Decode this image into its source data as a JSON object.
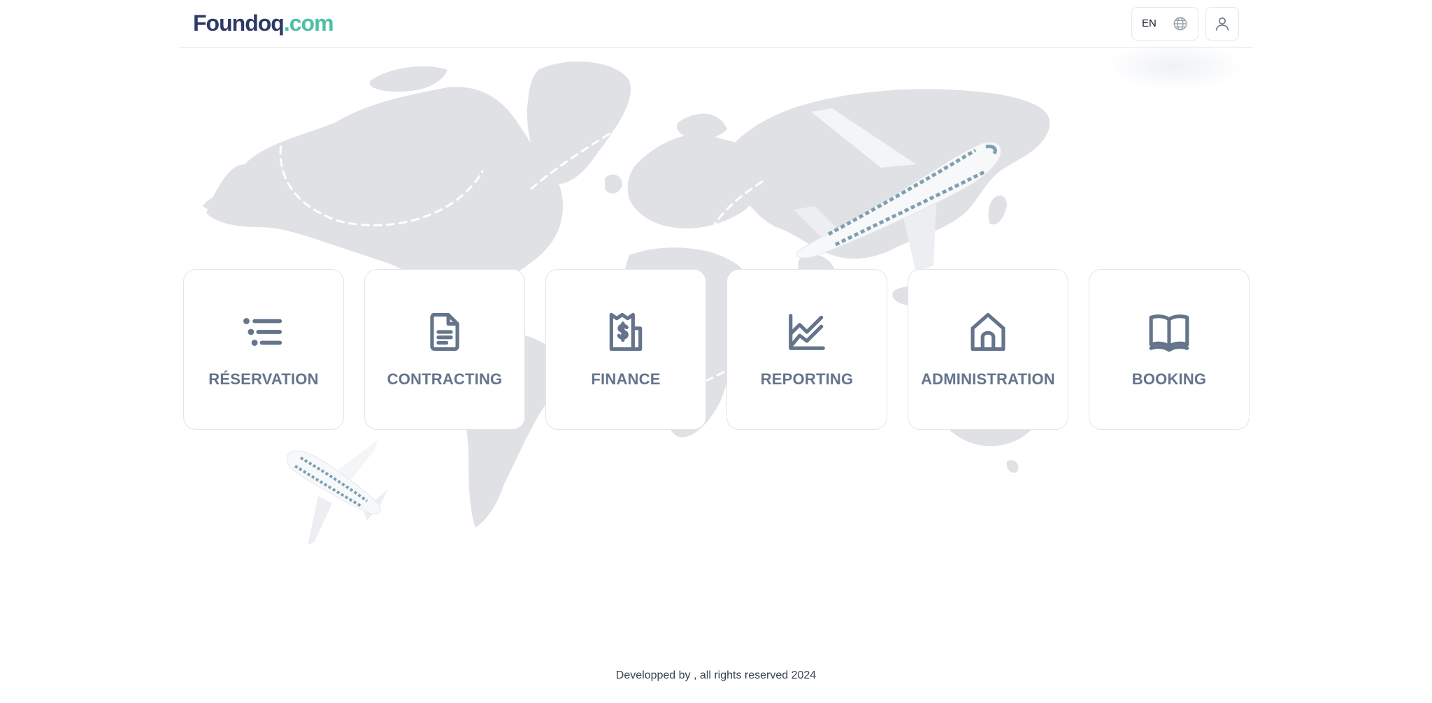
{
  "header": {
    "logo_part1": "Foundoq",
    "logo_part2": ".com",
    "language": "EN"
  },
  "icons": {
    "language": "globe-icon",
    "account": "user-icon"
  },
  "cards": [
    {
      "label": "RÉSERVATION",
      "icon": "list-icon"
    },
    {
      "label": "CONTRACTING",
      "icon": "document-icon"
    },
    {
      "label": "FINANCE",
      "icon": "receipt-dollar-icon"
    },
    {
      "label": "REPORTING",
      "icon": "chart-line-icon"
    },
    {
      "label": "ADMINISTRATION",
      "icon": "home-icon"
    },
    {
      "label": "BOOKING",
      "icon": "book-open-icon"
    }
  ],
  "footer": {
    "text": "Developped by , all rights reserved 2024"
  },
  "colors": {
    "brand_dark": "#2d3a66",
    "brand_accent": "#4cc0a4",
    "icon": "#64748b",
    "map": "#dfe1e5"
  }
}
